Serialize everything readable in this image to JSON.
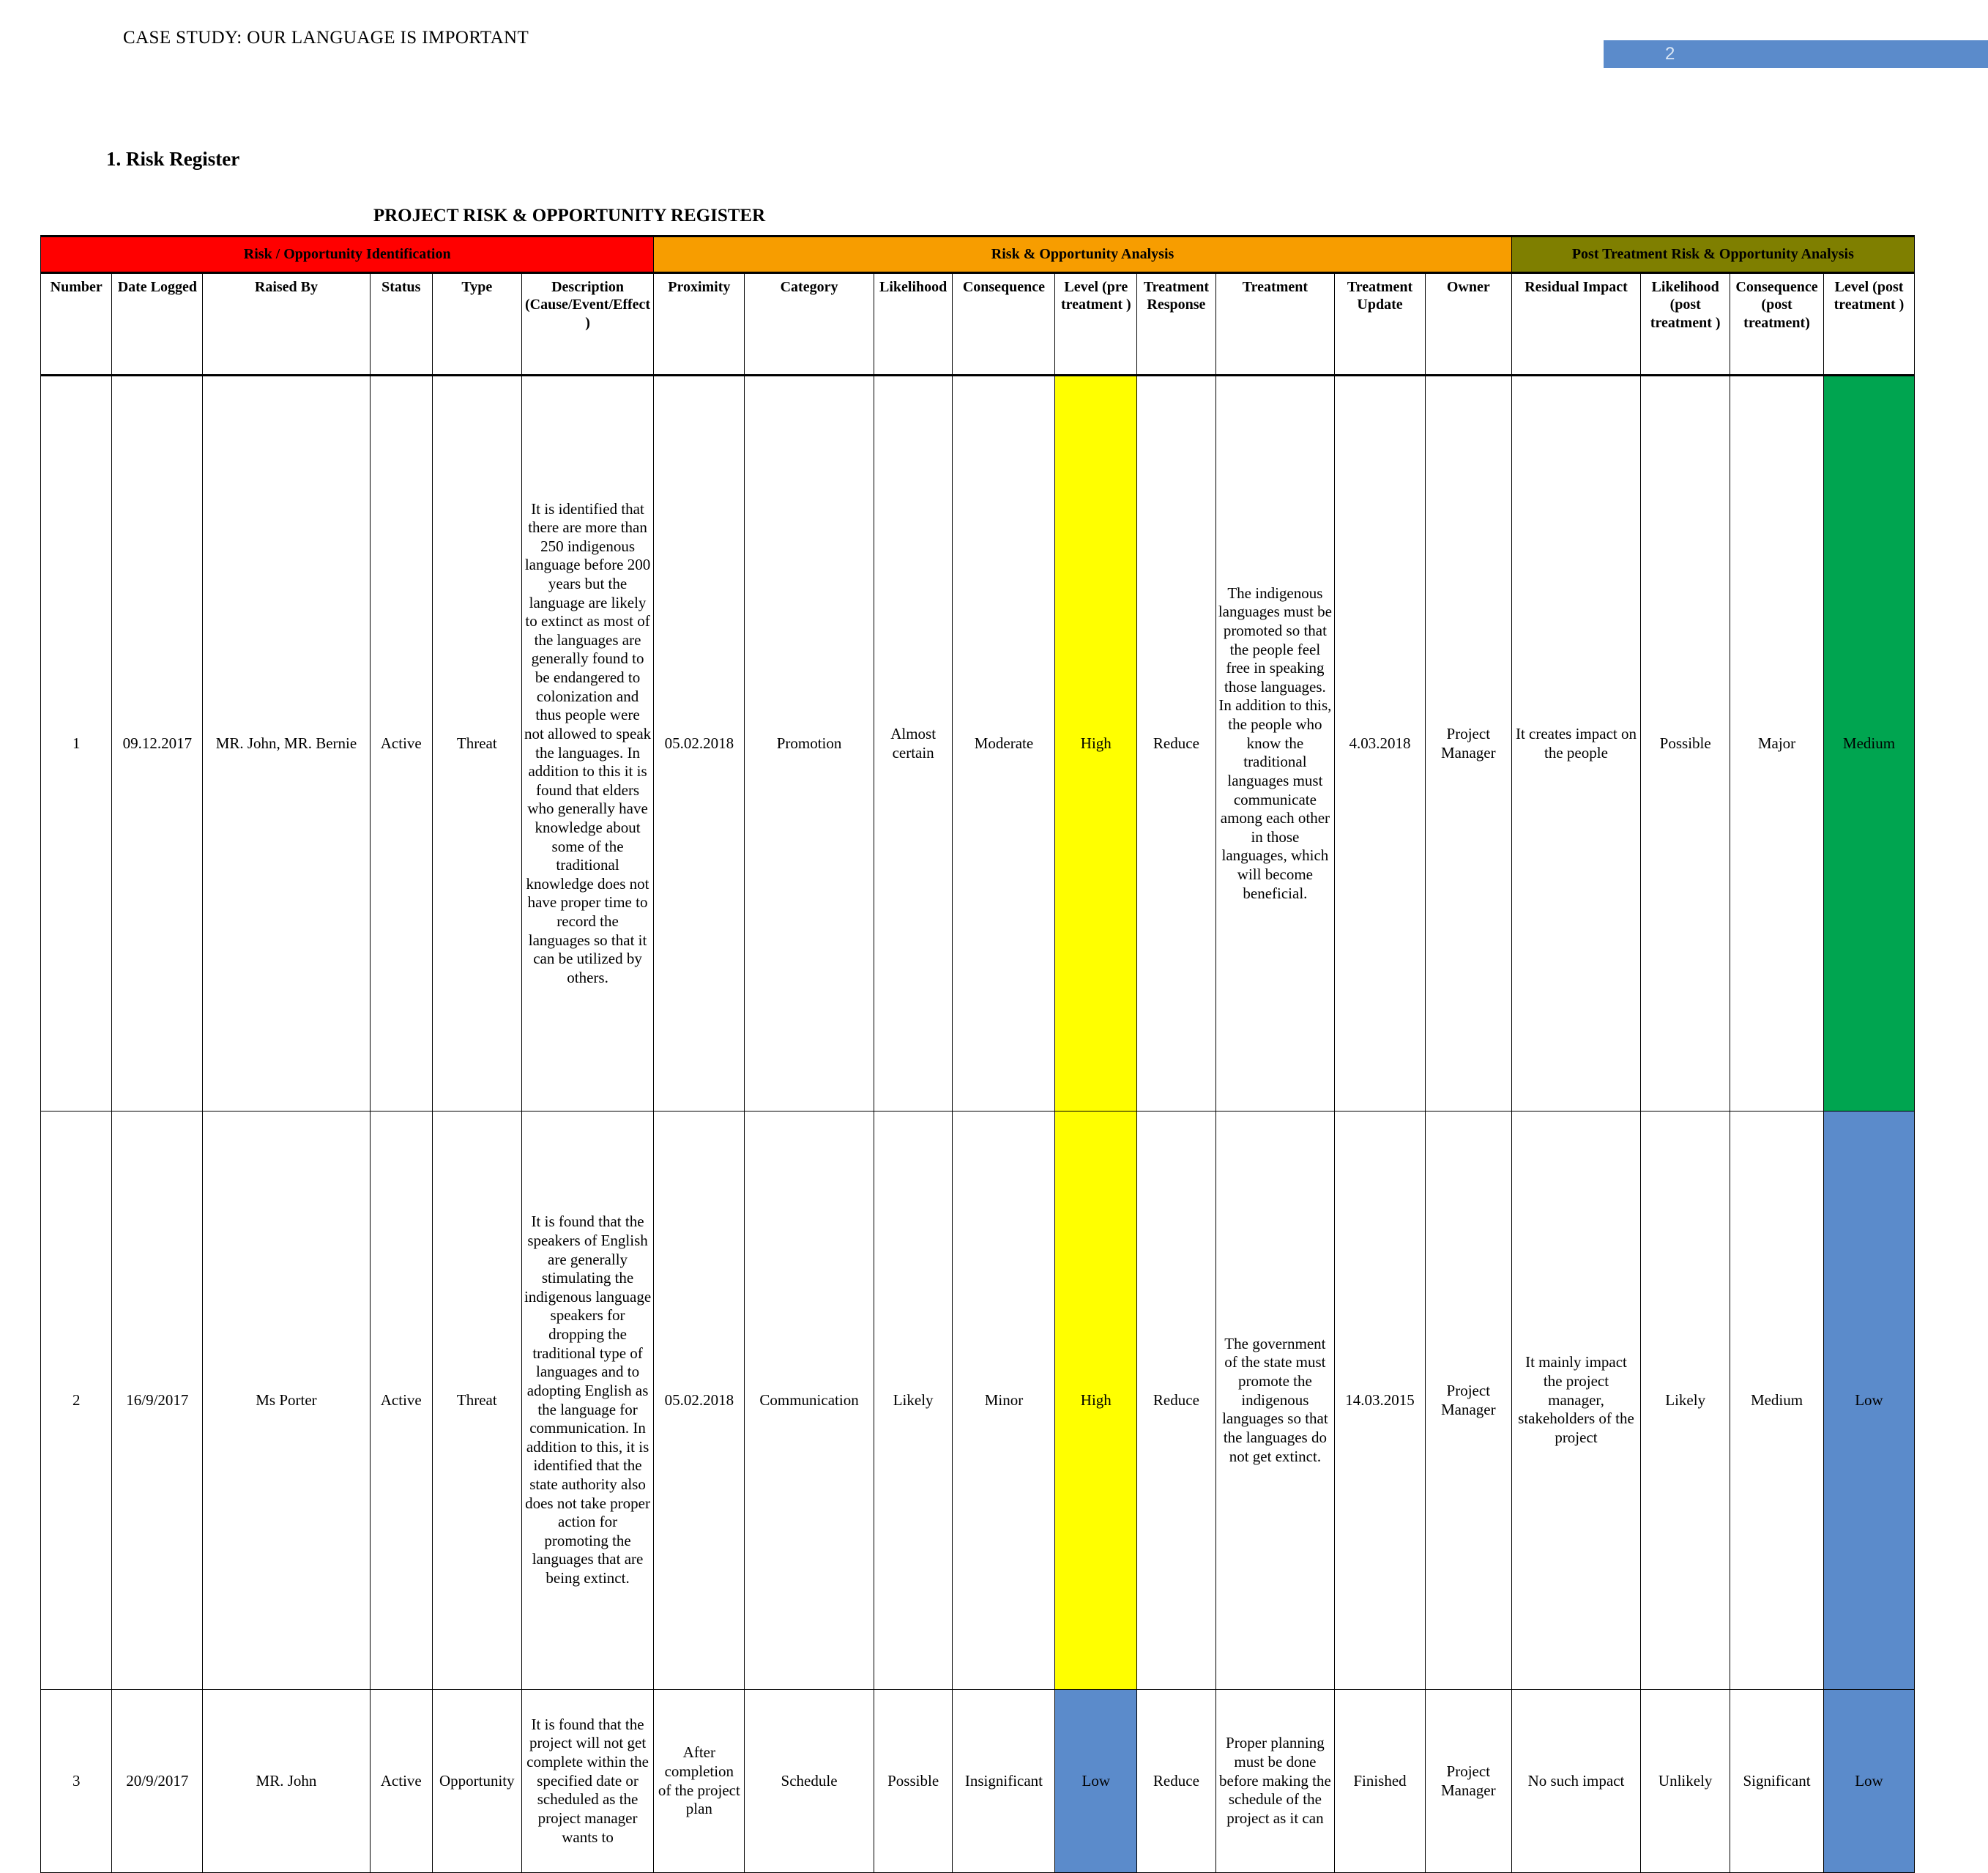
{
  "header": {
    "running_head": "CASE STUDY: OUR LANGUAGE IS IMPORTANT",
    "page_number": "2",
    "page_number_bar_color": "#5b8bcb"
  },
  "section": {
    "heading": "1. Risk Register"
  },
  "table": {
    "title": "PROJECT RISK & OPPORTUNITY REGISTER",
    "bands": [
      {
        "label": "Risk / Opportunity Identification",
        "color": "#ff0000",
        "span": 6
      },
      {
        "label": "Risk & Opportunity Analysis",
        "color": "#f79d00",
        "span": 9
      },
      {
        "label": "Post Treatment Risk & Opportunity Analysis",
        "color": "#7f7f00",
        "span": 4
      }
    ],
    "columns": [
      "Number",
      "Date Logged",
      "Raised By",
      "Status",
      "Type",
      "Description (Cause/Event/Effect)",
      "Proximity",
      "Category",
      "Likelihood",
      "Consequence",
      "Level (pre treatment )",
      "Treatment Response",
      "Treatment",
      "Treatment Update",
      "Owner",
      "Residual Impact",
      "Likelihood (post treatment )",
      "Consequence (post treatment)",
      "Level (post treatment )"
    ],
    "level_colors": {
      "High": "#ffff00",
      "Medium": "#00a550",
      "Low": "#5b8bcb"
    },
    "rows": [
      {
        "number": "1",
        "date_logged": "09.12.2017",
        "raised_by": "MR. John, MR. Bernie",
        "status": "Active",
        "type": "Threat",
        "description": "It is identified that there are more than 250 indigenous language before 200 years but the language are likely to extinct as most of the languages are generally found to be endangered to colonization and thus people were not allowed to speak the languages. In addition to this it is found that elders who generally have knowledge about some of the traditional knowledge does not have proper time to record the languages so that it can be utilized by others.",
        "proximity": "05.02.2018",
        "category": "Promotion",
        "likelihood": "Almost certain",
        "consequence": "Moderate",
        "level_pre": "High",
        "treatment_response": "Reduce",
        "treatment": " The indigenous languages must be promoted so that the people feel free in speaking those languages. In addition to this, the people who know the traditional languages must communicate among each other in those languages, which will become beneficial.",
        "treatment_update": "4.03.2018",
        "owner": "Project Manager",
        "residual_impact": "It creates impact on the people",
        "likelihood_post": "Possible",
        "consequence_post": "Major",
        "level_post": "Medium"
      },
      {
        "number": "2",
        "date_logged": "16/9/2017",
        "raised_by": "Ms Porter",
        "status": "Active",
        "type": "Threat",
        "description": " It is found that the speakers of English are generally stimulating the indigenous language speakers for dropping the traditional type of languages and to adopting English as the language for communication. In addition to this, it is identified that the state authority also does not take proper action for promoting the languages that are being extinct.",
        "proximity": "05.02.2018",
        "category": "Communication",
        "likelihood": "Likely",
        "consequence": "Minor",
        "level_pre": "High",
        "treatment_response": "Reduce",
        "treatment": "The government of the state must promote the indigenous languages so that the languages do not get extinct.",
        "treatment_update": "14.03.2015",
        "owner": "Project Manager",
        "residual_impact": "It mainly impact the project manager, stakeholders of the project",
        "likelihood_post": "Likely",
        "consequence_post": "Medium",
        "level_post": "Low"
      },
      {
        "number": "3",
        "date_logged": "20/9/2017",
        "raised_by": "MR. John",
        "status": "Active",
        "type": "Opportunity",
        "description": "It is found that the project will not get complete within the specified date or scheduled as the project manager wants to",
        "proximity": "After completion of the project plan",
        "category": "Schedule",
        "likelihood": "Possible",
        "consequence": "Insignificant",
        "level_pre": "Low",
        "treatment_response": "Reduce",
        "treatment": "Proper planning must be done before making the schedule of the project as it can",
        "treatment_update": "Finished",
        "owner": "Project Manager",
        "residual_impact": "No such impact",
        "likelihood_post": "Unlikely",
        "consequence_post": "Significant",
        "level_post": "Low"
      }
    ]
  }
}
